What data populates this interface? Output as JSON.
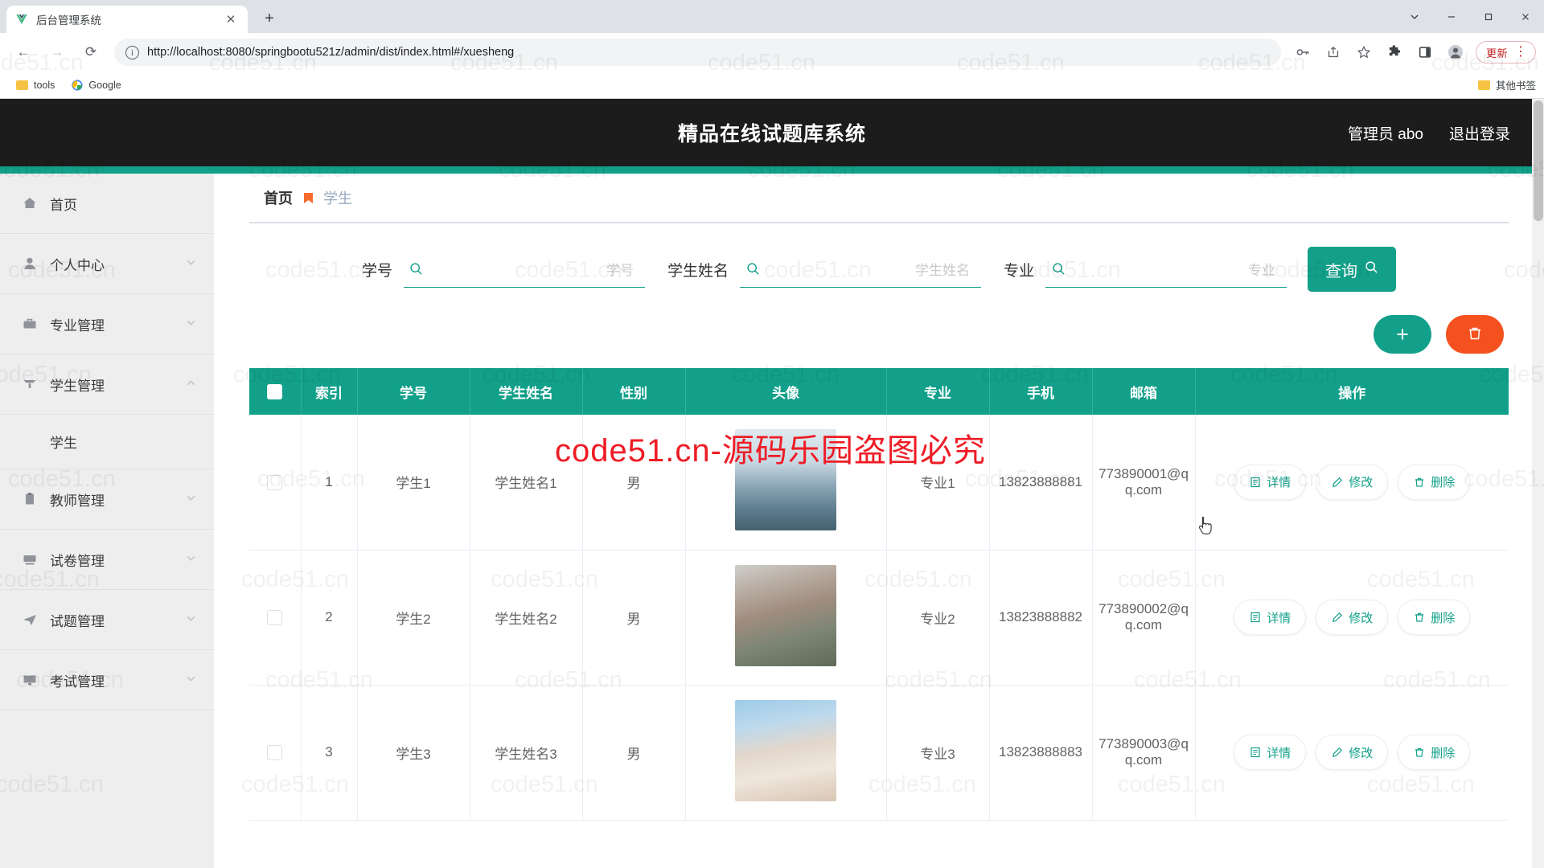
{
  "browser": {
    "tab": {
      "title": "后台管理系统",
      "favicon": "vue-logo-icon",
      "close": "✕"
    },
    "new_tab": "+",
    "window_controls": [
      "chevron-down-icon",
      "minimize-icon",
      "maximize-icon",
      "close-icon"
    ],
    "nav": {
      "back": "←",
      "forward": "→",
      "reload": "⟳"
    },
    "url": "http://localhost:8080/springbootu521z/admin/dist/index.html#/xuesheng",
    "toolbar_icons": [
      "key-icon",
      "share-icon",
      "star-icon",
      "extensions-icon",
      "sidepanel-icon",
      "profile-icon"
    ],
    "update_label": "更新",
    "kebab": "⋮",
    "bookmarks": [
      {
        "label": "tools",
        "icon": "folder-icon"
      },
      {
        "label": "Google",
        "icon": "google-icon"
      }
    ],
    "bookmarks_right": {
      "label": "其他书签",
      "icon": "folder-icon"
    }
  },
  "app": {
    "title": "精品在线试题库系统",
    "user_label": "管理员 abo",
    "logout_label": "退出登录",
    "accent_color": "#13a08a",
    "header_bg": "#1c1c1c"
  },
  "sidebar": {
    "items": [
      {
        "label": "首页",
        "icon": "home-icon",
        "has_arrow": false,
        "expanded": false
      },
      {
        "label": "个人中心",
        "icon": "user-icon",
        "has_arrow": true,
        "expanded": false
      },
      {
        "label": "专业管理",
        "icon": "briefcase-icon",
        "has_arrow": true,
        "expanded": false
      },
      {
        "label": "学生管理",
        "icon": "student-icon",
        "has_arrow": true,
        "expanded": true
      },
      {
        "label": "教师管理",
        "icon": "clipboard-icon",
        "has_arrow": true,
        "expanded": false
      },
      {
        "label": "试卷管理",
        "icon": "paper-icon",
        "has_arrow": true,
        "expanded": false
      },
      {
        "label": "试题管理",
        "icon": "send-icon",
        "has_arrow": true,
        "expanded": false
      },
      {
        "label": "考试管理",
        "icon": "monitor-icon",
        "has_arrow": true,
        "expanded": false
      }
    ],
    "submenu": {
      "parent": "学生管理",
      "label": "学生"
    }
  },
  "breadcrumb": {
    "home": "首页",
    "separator": "bookmark-icon",
    "current": "学生"
  },
  "filters": [
    {
      "label": "学号",
      "value": "",
      "placeholder": "学号",
      "icon": "search-icon"
    },
    {
      "label": "学生姓名",
      "value": "",
      "placeholder": "学生姓名",
      "icon": "search-icon"
    },
    {
      "label": "专业",
      "value": "",
      "placeholder": "专业",
      "icon": "search-icon"
    }
  ],
  "query_button": {
    "label": "查询",
    "icon": "search-icon"
  },
  "actions": {
    "add": {
      "label": "+",
      "color": "#13a08a",
      "name": "add-button"
    },
    "delete": {
      "label": "trash-icon",
      "color": "#f4511e",
      "name": "batch-delete-button"
    }
  },
  "table": {
    "columns": [
      "",
      "索引",
      "学号",
      "学生姓名",
      "性别",
      "头像",
      "专业",
      "手机",
      "邮箱",
      "操作"
    ],
    "select_all": false,
    "rows": [
      {
        "checked": false,
        "index": "1",
        "xuehao": "学生1",
        "name": "学生姓名1",
        "gender": "男",
        "avatar": "avatar-photo-1",
        "major": "专业1",
        "phone": "13823888881",
        "email": "773890001@qq.com"
      },
      {
        "checked": false,
        "index": "2",
        "xuehao": "学生2",
        "name": "学生姓名2",
        "gender": "男",
        "avatar": "avatar-photo-2",
        "major": "专业2",
        "phone": "13823888882",
        "email": "773890002@qq.com"
      },
      {
        "checked": false,
        "index": "3",
        "xuehao": "学生3",
        "name": "学生姓名3",
        "gender": "男",
        "avatar": "avatar-photo-3",
        "major": "专业3",
        "phone": "13823888883",
        "email": "773890003@qq.com"
      }
    ],
    "row_actions": [
      {
        "label": "详情",
        "icon": "detail-icon"
      },
      {
        "label": "修改",
        "icon": "edit-icon"
      },
      {
        "label": "删除",
        "icon": "trash-icon"
      }
    ]
  },
  "watermarks": {
    "text": "code51.cn",
    "red_text": "code51.cn-源码乐园盗图必究"
  }
}
